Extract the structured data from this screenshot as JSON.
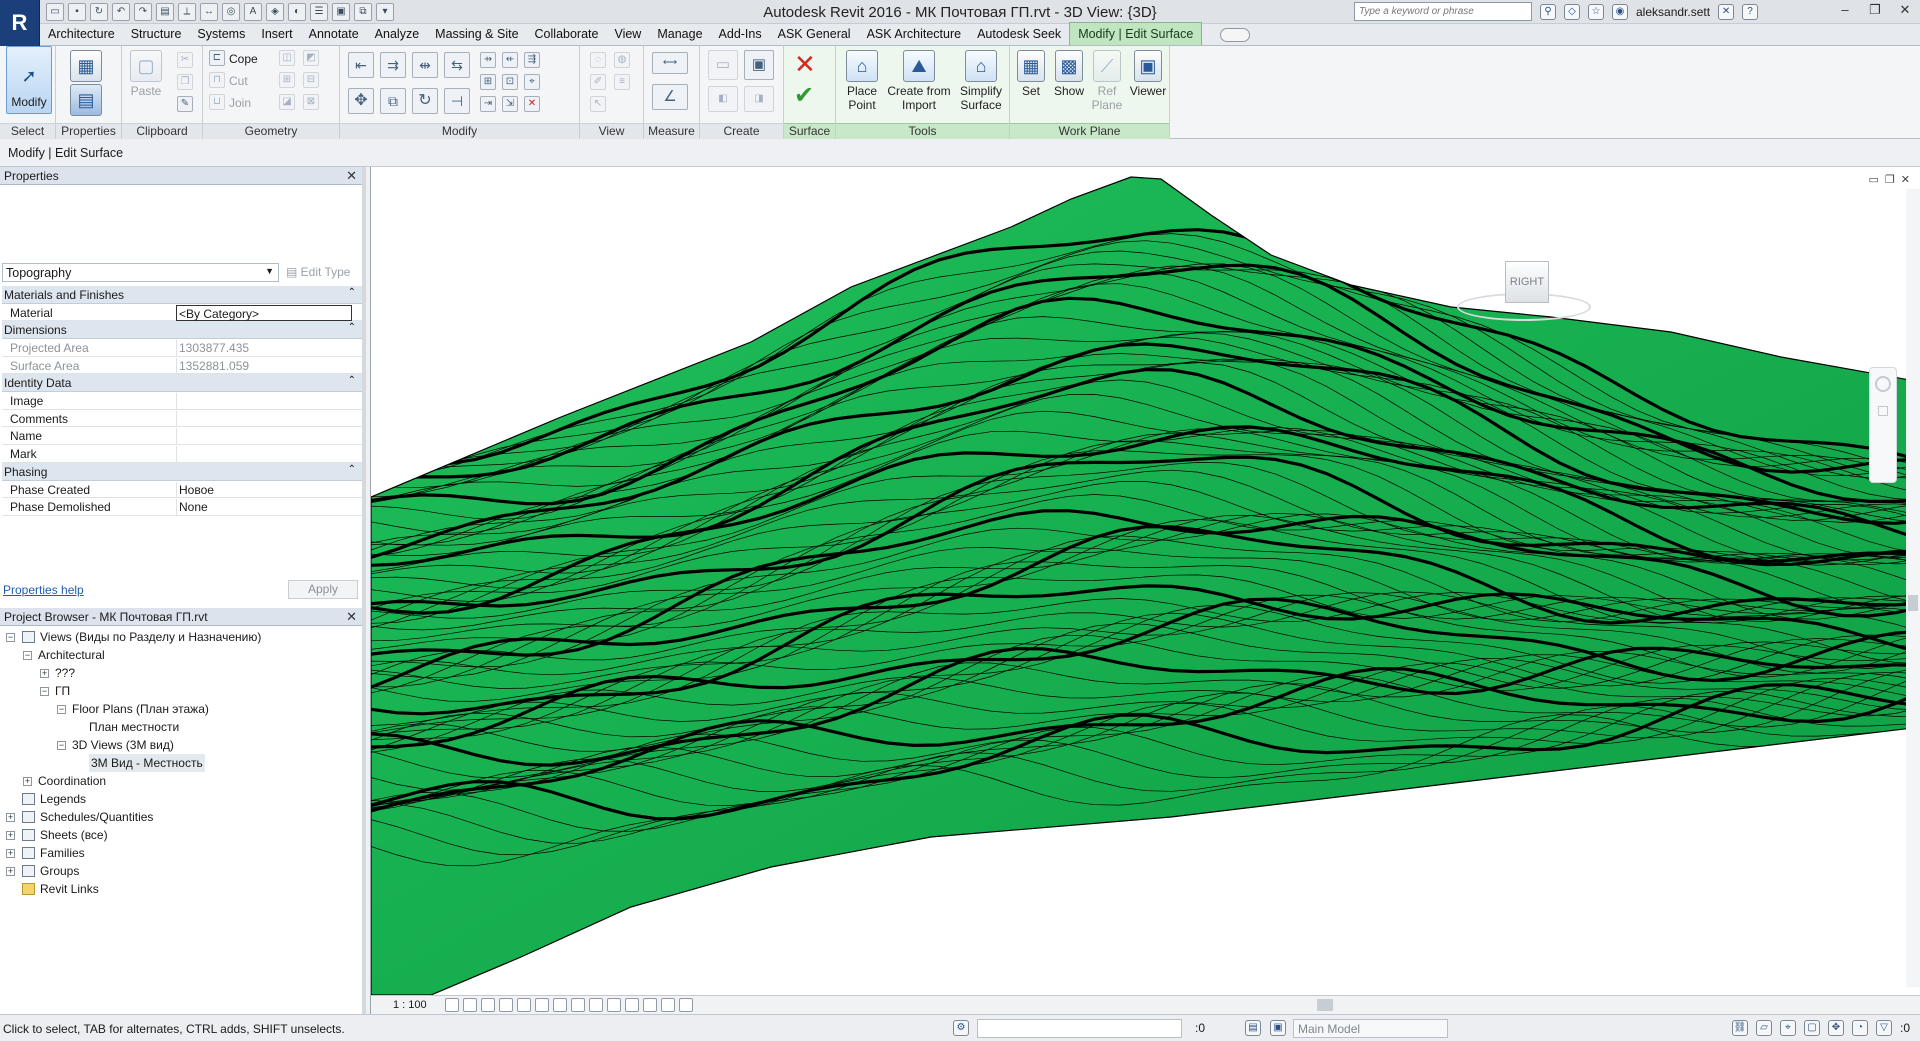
{
  "app": {
    "title": "Autodesk Revit 2016 -    МК Почтовая ГП.rvt - 3D View: {3D}",
    "search_placeholder": "Type a keyword or phrase",
    "user": "aleksandr.sett",
    "logo_letter": "R"
  },
  "ribbon_tabs": [
    "Architecture",
    "Structure",
    "Systems",
    "Insert",
    "Annotate",
    "Analyze",
    "Massing & Site",
    "Collaborate",
    "View",
    "Manage",
    "Add-Ins",
    "ASK General",
    "ASK Architecture",
    "Autodesk Seek",
    "Modify | Edit Surface"
  ],
  "ribbon": {
    "select": {
      "modify": "Modify",
      "title": "Select"
    },
    "properties": {
      "title": "Properties"
    },
    "clipboard": {
      "paste": "Paste",
      "title": "Clipboard"
    },
    "geometry": {
      "cope": "Cope",
      "cut": "Cut",
      "join": "Join",
      "title": "Geometry"
    },
    "modify": {
      "title": "Modify"
    },
    "view": {
      "title": "View"
    },
    "measure": {
      "title": "Measure"
    },
    "create": {
      "title": "Create"
    },
    "surface": {
      "title": "Surface"
    },
    "tools": {
      "place_point": "Place Point",
      "create_from_import": "Create from Import",
      "simplify_surface": "Simplify Surface",
      "title": "Tools"
    },
    "work_plane": {
      "set": "Set",
      "show": "Show",
      "ref_plane": "Ref Plane",
      "viewer": "Viewer",
      "title": "Work Plane"
    }
  },
  "options_bar": {
    "context": "Modify | Edit Surface"
  },
  "properties_panel": {
    "title": "Properties",
    "type_name": "Topography",
    "edit_type": "Edit Type",
    "sections": [
      {
        "name": "Materials and Finishes",
        "rows": [
          {
            "name": "Material",
            "value": "<By Category>"
          }
        ]
      },
      {
        "name": "Dimensions",
        "rows": [
          {
            "name": "Projected Area",
            "value": "1303877.435"
          },
          {
            "name": "Surface Area",
            "value": "1352881.059"
          }
        ]
      },
      {
        "name": "Identity Data",
        "rows": [
          {
            "name": "Image",
            "value": ""
          },
          {
            "name": "Comments",
            "value": ""
          },
          {
            "name": "Name",
            "value": ""
          },
          {
            "name": "Mark",
            "value": ""
          }
        ]
      },
      {
        "name": "Phasing",
        "rows": [
          {
            "name": "Phase Created",
            "value": "Новое"
          },
          {
            "name": "Phase Demolished",
            "value": "None"
          }
        ]
      }
    ],
    "help_link": "Properties help",
    "apply": "Apply"
  },
  "project_browser": {
    "title": "Project Browser - МК Почтовая ГП.rvt",
    "tree": [
      {
        "label": "Views (Виды по Разделу и Назначению)",
        "level": 0,
        "exp": "−"
      },
      {
        "label": "Architectural",
        "level": 1,
        "exp": "−"
      },
      {
        "label": "???",
        "level": 2,
        "exp": "+"
      },
      {
        "label": "ГП",
        "level": 2,
        "exp": "−"
      },
      {
        "label": "Floor Plans (План этажа)",
        "level": 3,
        "exp": "−"
      },
      {
        "label": "План местности",
        "level": 4,
        "exp": ""
      },
      {
        "label": "3D Views (3М вид)",
        "level": 3,
        "exp": "−"
      },
      {
        "label": "3М Вид - Местность",
        "level": 4,
        "exp": "",
        "selected": true
      },
      {
        "label": "Coordination",
        "level": 1,
        "exp": "+"
      },
      {
        "label": "Legends",
        "level": 0,
        "exp": ""
      },
      {
        "label": "Schedules/Quantities",
        "level": 0,
        "exp": "+"
      },
      {
        "label": "Sheets (все)",
        "level": 0,
        "exp": "+"
      },
      {
        "label": "Families",
        "level": 0,
        "exp": "+"
      },
      {
        "label": "Groups",
        "level": 0,
        "exp": "+"
      },
      {
        "label": "Revit Links",
        "level": 0,
        "exp": ""
      }
    ]
  },
  "viewport": {
    "viewcube_label": "RIGHT",
    "scale": "1 : 100",
    "terrain_color": "#14a84c"
  },
  "status_bar": {
    "message": "Click to select, TAB for alternates, CTRL adds, SHIFT unselects.",
    "count": ":0",
    "model": "Main Model",
    "filter_count": ":0"
  }
}
